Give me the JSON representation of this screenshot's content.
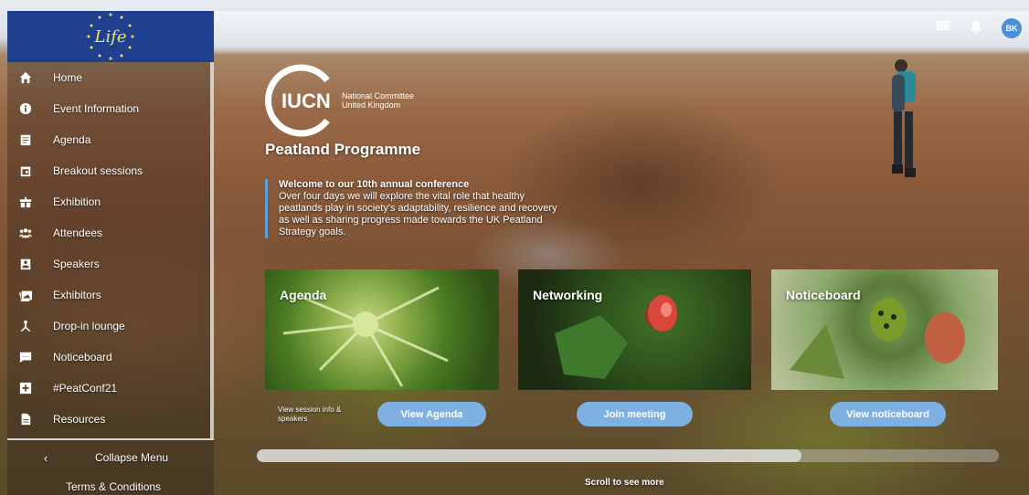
{
  "sidebar": {
    "logo_text": "Life",
    "items": [
      {
        "label": "Home",
        "icon": "home-icon"
      },
      {
        "label": "Event Information",
        "icon": "info-icon"
      },
      {
        "label": "Agenda",
        "icon": "agenda-icon"
      },
      {
        "label": "Breakout sessions",
        "icon": "calendar-icon"
      },
      {
        "label": "Exhibition",
        "icon": "gift-icon"
      },
      {
        "label": "Attendees",
        "icon": "group-icon"
      },
      {
        "label": "Speakers",
        "icon": "contact-icon"
      },
      {
        "label": "Exhibitors",
        "icon": "photo-icon"
      },
      {
        "label": "Drop-in lounge",
        "icon": "hub-icon"
      },
      {
        "label": "Noticeboard",
        "icon": "chat-icon"
      },
      {
        "label": "#PeatConf21",
        "icon": "plus-box-icon"
      },
      {
        "label": "Resources",
        "icon": "document-icon"
      }
    ],
    "collapse_label": "Collapse Menu",
    "terms_label": "Terms & Conditions"
  },
  "topbar": {
    "avatar_initials": "BK",
    "icons": [
      "message-icon",
      "bell-icon"
    ]
  },
  "hero": {
    "logo_text": "IUCN",
    "logo_sub1": "National Committee",
    "logo_sub2": "United Kingdom",
    "programme": "Peatland Programme",
    "welcome_title": "Welcome to our 10th annual conference",
    "welcome_body": "Over four days we will explore the vital role that healthy peatlands play in society's adaptability, resilience and recovery as well as sharing progress made towards the UK Peatland Strategy goals."
  },
  "cards": {
    "agenda": {
      "title": "Agenda",
      "button": "View Agenda",
      "note": "View session info & speakers"
    },
    "networking": {
      "title": "Networking",
      "button": "Join meeting"
    },
    "noticeboard": {
      "title": "Noticeboard",
      "button": "View noticeboard"
    }
  },
  "scroll_hint": "Scroll to see more",
  "colors": {
    "brand_blue": "#1f3f8f",
    "button_blue": "#7fb0e2",
    "accent_line": "#5ba0d8",
    "avatar": "#4a90d8"
  }
}
